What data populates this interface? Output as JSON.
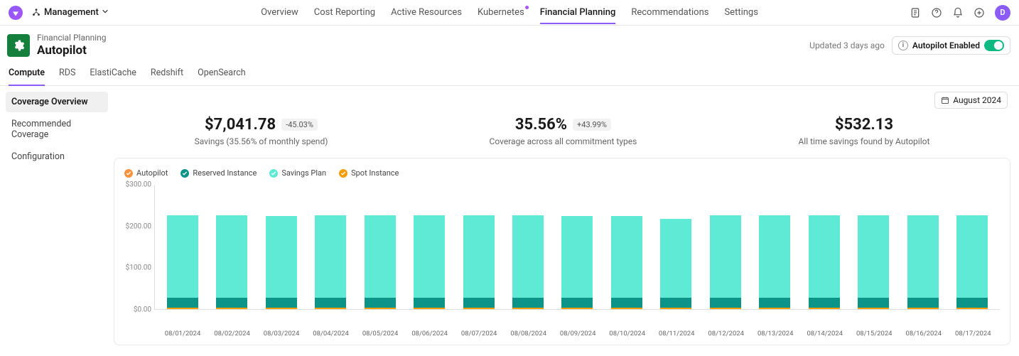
{
  "topbar": {
    "workspace": "Management",
    "nav": [
      "Overview",
      "Cost Reporting",
      "Active Resources",
      "Kubernetes",
      "Financial Planning",
      "Recommendations",
      "Settings"
    ],
    "nav_active": "Financial Planning",
    "nav_has_dot": "Kubernetes",
    "avatar_initial": "D"
  },
  "header": {
    "breadcrumb": "Financial Planning",
    "title": "Autopilot",
    "updated": "Updated 3 days ago",
    "autopilot_label": "Autopilot Enabled"
  },
  "subtabs": [
    "Compute",
    "RDS",
    "ElastiCache",
    "Redshift",
    "OpenSearch"
  ],
  "subtab_active": "Compute",
  "sidebar": {
    "items": [
      "Coverage Overview",
      "Recommended Coverage",
      "Configuration"
    ],
    "active": "Coverage Overview"
  },
  "date_range": "August 2024",
  "kpis": [
    {
      "value": "$7,041.78",
      "badge": "-45.03%",
      "sub": "Savings (35.56% of monthly spend)"
    },
    {
      "value": "35.56%",
      "badge": "+43.99%",
      "sub": "Coverage across all commitment types"
    },
    {
      "value": "$532.13",
      "badge": "",
      "sub": "All time savings found by Autopilot"
    }
  ],
  "chart_data": {
    "type": "bar",
    "title": "",
    "ylabel": "",
    "ylim": [
      0,
      300
    ],
    "yticks": [
      "$300.00",
      "$200.00",
      "$100.00",
      "$0.00"
    ],
    "legend": [
      {
        "name": "Autopilot",
        "color": "#fb923c"
      },
      {
        "name": "Reserved Instance",
        "color": "#0d9488"
      },
      {
        "name": "Savings Plan",
        "color": "#5eead4"
      },
      {
        "name": "Spot Instance",
        "color": "#f59e0b"
      }
    ],
    "categories": [
      "08/01/2024",
      "08/02/2024",
      "08/03/2024",
      "08/04/2024",
      "08/05/2024",
      "08/06/2024",
      "08/07/2024",
      "08/08/2024",
      "08/09/2024",
      "08/10/2024",
      "08/11/2024",
      "08/12/2024",
      "08/13/2024",
      "08/14/2024",
      "08/15/2024",
      "08/16/2024",
      "08/17/2024"
    ],
    "series": [
      {
        "name": "Spot Instance",
        "values": [
          3,
          3,
          3,
          3,
          3,
          3,
          3,
          3,
          3,
          3,
          3,
          3,
          3,
          3,
          3,
          3,
          3
        ]
      },
      {
        "name": "Reserved Instance",
        "values": [
          25,
          25,
          25,
          25,
          25,
          25,
          25,
          25,
          25,
          25,
          25,
          25,
          25,
          25,
          25,
          25,
          25
        ]
      },
      {
        "name": "Savings Plan",
        "values": [
          197,
          197,
          195,
          197,
          197,
          197,
          197,
          197,
          195,
          195,
          188,
          197,
          197,
          197,
          197,
          197,
          197
        ]
      },
      {
        "name": "Autopilot",
        "values": [
          0,
          0,
          0,
          0,
          0,
          0,
          0,
          0,
          0,
          0,
          0,
          0,
          0,
          0,
          0,
          0,
          0
        ]
      }
    ]
  }
}
